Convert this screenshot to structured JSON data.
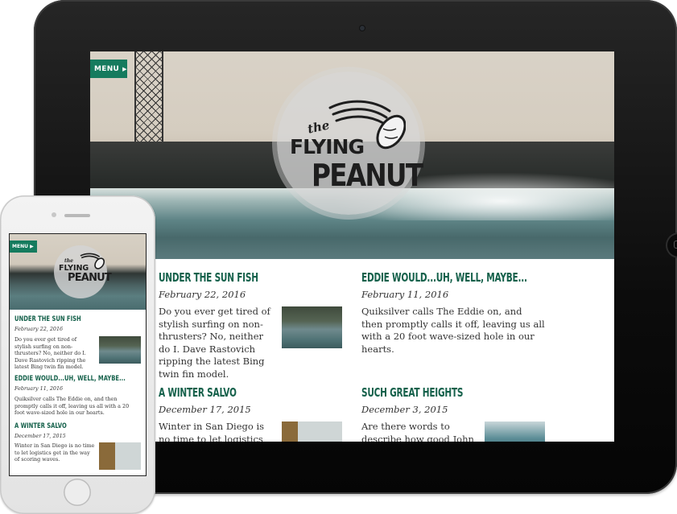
{
  "brand": {
    "the": "the",
    "flying": "FLYING",
    "peanut": "PEANUT"
  },
  "menu": {
    "label": "MENU"
  },
  "colors": {
    "accent": "#157b5e",
    "title": "#15614b"
  },
  "posts": [
    {
      "title": "UNDER THE SUN FISH",
      "date": "February 22, 2016",
      "excerpt_tablet": "Do you ever get tired of stylish surfing on non-thrusters? No, neither do I. Dave Rastovich ripping the latest Bing twin fin model.",
      "excerpt_phone": "Do you ever get tired of stylish surfing on non-thrusters? No, neither do I. Dave Rastovich ripping the latest Bing twin fin model."
    },
    {
      "title": "EDDIE WOULD...UH, WELL, MAYBE...",
      "date": "February 11, 2016",
      "excerpt_tablet": "Quiksilver calls The Eddie on, and then promptly calls it off, leaving us all with a 20 foot wave-sized hole in our hearts.",
      "excerpt_phone": "Quiksilver calls The Eddie on, and then promptly calls it off, leaving us all with a 20 foot wave-sized hole in our hearts."
    },
    {
      "title": "A WINTER SALVO",
      "date": "December 17, 2015",
      "excerpt_tablet": "Winter in San Diego is no time to let logistics get in",
      "excerpt_phone": "Winter in San Diego is no time to let logistics get in the way of scoring waves."
    },
    {
      "title": "SUCH GREAT HEIGHTS",
      "date": "December 3, 2015",
      "excerpt_tablet": "Are there words to describe how good John"
    }
  ]
}
